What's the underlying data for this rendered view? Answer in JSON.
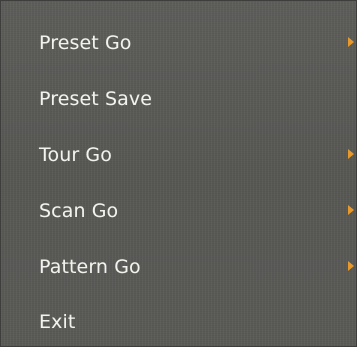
{
  "menu": {
    "items": [
      {
        "label": "Preset Go",
        "has_submenu": true
      },
      {
        "label": "Preset Save",
        "has_submenu": false
      },
      {
        "label": "Tour Go",
        "has_submenu": true
      },
      {
        "label": "Scan Go",
        "has_submenu": true
      },
      {
        "label": "Pattern Go",
        "has_submenu": true
      },
      {
        "label": "Exit",
        "has_submenu": false
      }
    ]
  },
  "colors": {
    "menu_background": "#5b5b58",
    "text": "#f2f2ee",
    "submenu_arrow": "#e79a2b"
  },
  "icons": {
    "submenu_indicator": "caret-right-icon"
  }
}
